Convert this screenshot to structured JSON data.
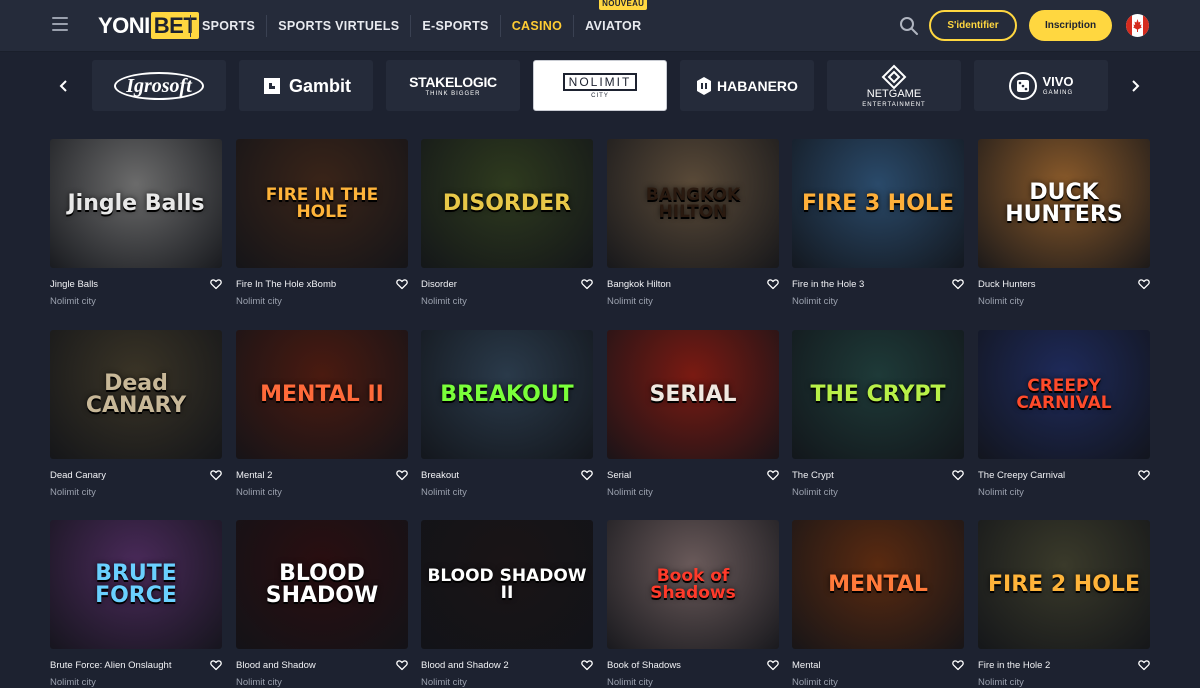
{
  "header": {
    "logo_part1": "YONI",
    "logo_part2": "BET",
    "nav": [
      {
        "label": "SPORTS",
        "active": false
      },
      {
        "label": "SPORTS VIRTUELS",
        "active": false
      },
      {
        "label": "E-SPORTS",
        "active": false
      },
      {
        "label": "CASINO",
        "active": true
      },
      {
        "label": "AVIATOR",
        "active": false,
        "badge": "NOUVEAU"
      }
    ],
    "login_label": "S'identifier",
    "register_label": "Inscription",
    "accent_color": "#ffd740"
  },
  "providers": [
    {
      "name": "Igrosoft",
      "active": false
    },
    {
      "name": "Gambit",
      "active": false
    },
    {
      "name": "STAKELOGIC",
      "sub": "THINK BIGGER",
      "active": false
    },
    {
      "name": "NOLIMIT",
      "sub": "CITY",
      "active": true
    },
    {
      "name": "HABANERO",
      "active": false
    },
    {
      "name": "NETGAME",
      "sub": "ENTERTAINMENT",
      "active": false
    },
    {
      "name": "VIVO",
      "sub": "GAMING",
      "active": false
    }
  ],
  "games": [
    {
      "title": "Jingle Balls",
      "provider": "Nolimit city",
      "art": "Jingle Balls",
      "bg": "#6b6b6b",
      "fg": "#e8e8e8"
    },
    {
      "title": "Fire In The Hole xBomb",
      "provider": "Nolimit city",
      "art": "FIRE IN THE HOLE",
      "bg": "#3a2418",
      "fg": "#ffb43a"
    },
    {
      "title": "Disorder",
      "provider": "Nolimit city",
      "art": "DISORDER",
      "bg": "#2e3a1e",
      "fg": "#e8c848"
    },
    {
      "title": "Bangkok Hilton",
      "provider": "Nolimit city",
      "art": "BANGKOK HILTON",
      "bg": "#5a4a38",
      "fg": "#2a1a10"
    },
    {
      "title": "Fire in the Hole 3",
      "provider": "Nolimit city",
      "art": "FIRE 3 HOLE",
      "bg": "#2a4a6a",
      "fg": "#ffb03a"
    },
    {
      "title": "Duck Hunters",
      "provider": "Nolimit city",
      "art": "DUCK HUNTERS",
      "bg": "#8a5a2a",
      "fg": "#ffffff"
    },
    {
      "title": "Dead Canary",
      "provider": "Nolimit city",
      "art": "Dead CANARY",
      "bg": "#3a3426",
      "fg": "#c8b898"
    },
    {
      "title": "Mental 2",
      "provider": "Nolimit city",
      "art": "MENTAL II",
      "bg": "#4a1a10",
      "fg": "#ff6a3a"
    },
    {
      "title": "Breakout",
      "provider": "Nolimit city",
      "art": "BREAKOUT",
      "bg": "#2a3a4a",
      "fg": "#7aff3a"
    },
    {
      "title": "Serial",
      "provider": "Nolimit city",
      "art": "SERIAL",
      "bg": "#7a1a12",
      "fg": "#f0e8e0"
    },
    {
      "title": "The Crypt",
      "provider": "Nolimit city",
      "art": "THE CRYPT",
      "bg": "#1e3a38",
      "fg": "#b8f048"
    },
    {
      "title": "The Creepy Carnival",
      "provider": "Nolimit city",
      "art": "CREEPY CARNIVAL",
      "bg": "#1e2a5a",
      "fg": "#ff4a2a"
    },
    {
      "title": "Brute Force: Alien Onslaught",
      "provider": "Nolimit city",
      "art": "BRUTE FORCE",
      "bg": "#4a2a5a",
      "fg": "#6ad0ff"
    },
    {
      "title": "Blood and Shadow",
      "provider": "Nolimit city",
      "art": "BLOOD SHADOW",
      "bg": "#2a0e10",
      "fg": "#ffffff"
    },
    {
      "title": "Blood and Shadow 2",
      "provider": "Nolimit city",
      "art": "BLOOD SHADOW II",
      "bg": "#1a1416",
      "fg": "#ffffff"
    },
    {
      "title": "Book of Shadows",
      "provider": "Nolimit city",
      "art": "Book of Shadows",
      "bg": "#6a5a5a",
      "fg": "#ff3a2a"
    },
    {
      "title": "Mental",
      "provider": "Nolimit city",
      "art": "MENTAL",
      "bg": "#5a2a10",
      "fg": "#ff7a3a"
    },
    {
      "title": "Fire in the Hole 2",
      "provider": "Nolimit city",
      "art": "FIRE 2 HOLE",
      "bg": "#3a3a2a",
      "fg": "#ffb43a"
    }
  ]
}
